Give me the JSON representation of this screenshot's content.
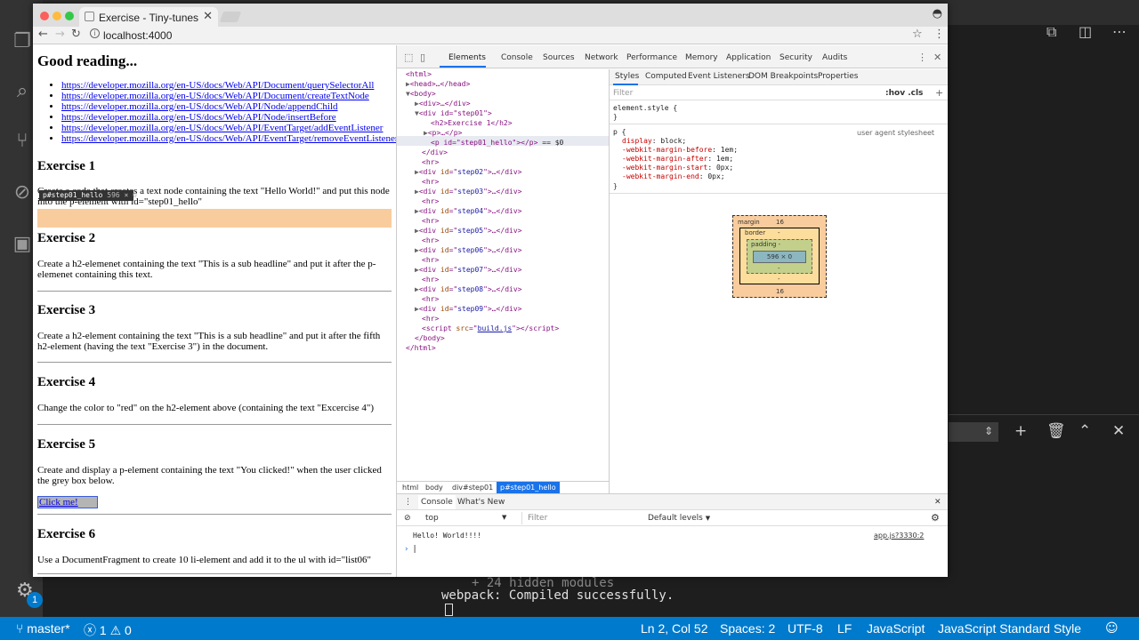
{
  "chrome": {
    "tab_title": "Exercise - Tiny-tunes",
    "url": "localhost:4000"
  },
  "page": {
    "heading": "Good reading...",
    "links": [
      "https://developer.mozilla.org/en-US/docs/Web/API/Document/querySelectorAll",
      "https://developer.mozilla.org/en-US/docs/Web/API/Document/createTextNode",
      "https://developer.mozilla.org/en-US/docs/Web/API/Node/appendChild",
      "https://developer.mozilla.org/en-US/docs/Web/API/Node/insertBefore",
      "https://developer.mozilla.org/en-US/docs/Web/API/EventTarget/addEventListener",
      "https://developer.mozilla.org/en-US/docs/Web/API/EventTarget/removeEventListener"
    ],
    "exercises": [
      {
        "title": "Exercise 1",
        "text": "Create a code that creates a text node containing the text \"Hello World!\" and put this node into the p-element with id=\"step01_hello\""
      },
      {
        "title": "Exercise 2",
        "text": "Create a h2-elemenet containing the text \"This is a sub headline\" and put it after the p-elemenet containing this text."
      },
      {
        "title": "Exercise 3",
        "text": "Create a h2-element containing the text \"This is a sub headline\" and put it after the fifth h2-element (having the text \"Exercise 3\") in the document."
      },
      {
        "title": "Exercise 4",
        "text": "Change the color to \"red\" on the h2-element above (containing the text \"Excercise 4\")"
      },
      {
        "title": "Exercise 5",
        "text": "Create and display a p-element containing the text \"You clicked!\" when the user clicked the grey box below."
      },
      {
        "title": "Exercise 6",
        "text": "Use a DocumentFragment to create 10 li-element and add it to the ul with id=\"list06\""
      }
    ],
    "click_button": "Click me!",
    "tooltip_selector": "p#step01_hello",
    "tooltip_size": "596 × 0"
  },
  "devtools": {
    "tabs": [
      "Elements",
      "Console",
      "Sources",
      "Network",
      "Performance",
      "Memory",
      "Application",
      "Security",
      "Audits"
    ],
    "dom": {
      "html_open": "<html>",
      "head": "<head>…</head>",
      "body_open": "<body>",
      "div_empty": "<div>…</div>",
      "step01_open": "<div id=\"step01\">",
      "h2": "<h2>Exercise 1</h2>",
      "p_collapsed": "<p>…</p>",
      "p_selected": "<p id=\"step01_hello\"></p>",
      "selected_marker": "== $0",
      "div_close": "</div>",
      "hr": "<hr>",
      "steps": [
        "step02",
        "step03",
        "step04",
        "step05",
        "step06",
        "step07",
        "step08",
        "step09"
      ],
      "script": "build.js",
      "body_close": "</body>",
      "html_close": "</html>"
    },
    "breadcrumb": [
      "html",
      "body",
      "div#step01",
      "p#step01_hello"
    ],
    "styles_tabs": [
      "Styles",
      "Computed",
      "Event Listeners",
      "DOM Breakpoints",
      "Properties"
    ],
    "filter_placeholder": "Filter",
    "hov_cls": ":hov .cls",
    "element_style": "element.style {",
    "rule_selector": "p {",
    "ua_label": "user agent stylesheet",
    "rule_props": [
      {
        "p": "display",
        "v": "block;"
      },
      {
        "p": "-webkit-margin-before",
        "v": "1em;"
      },
      {
        "p": "-webkit-margin-after",
        "v": "1em;"
      },
      {
        "p": "-webkit-margin-start",
        "v": "0px;"
      },
      {
        "p": "-webkit-margin-end",
        "v": "0px;"
      }
    ],
    "box_model": {
      "margin_label": "margin",
      "margin_top": "16",
      "margin_bottom": "16",
      "border_label": "border",
      "padding_label": "padding -",
      "content": "596 × 0",
      "dash": "-"
    },
    "console": {
      "tabs": [
        "Console",
        "What's New"
      ],
      "context": "top",
      "filter_placeholder": "Filter",
      "levels": "Default levels",
      "log": "Hello! World!!!!",
      "source": "app.js?3330:2"
    }
  },
  "vscode": {
    "terminal_line1": "+ 24 hidden modules",
    "terminal_line2": "webpack: Compiled successfully.",
    "status": {
      "branch": "master*",
      "errors": "1",
      "warnings": "0",
      "position": "Ln 2, Col 52",
      "spaces": "Spaces: 2",
      "encoding": "UTF-8",
      "eol": "LF",
      "language": "JavaScript",
      "style": "JavaScript Standard Style"
    },
    "badge": "1"
  }
}
